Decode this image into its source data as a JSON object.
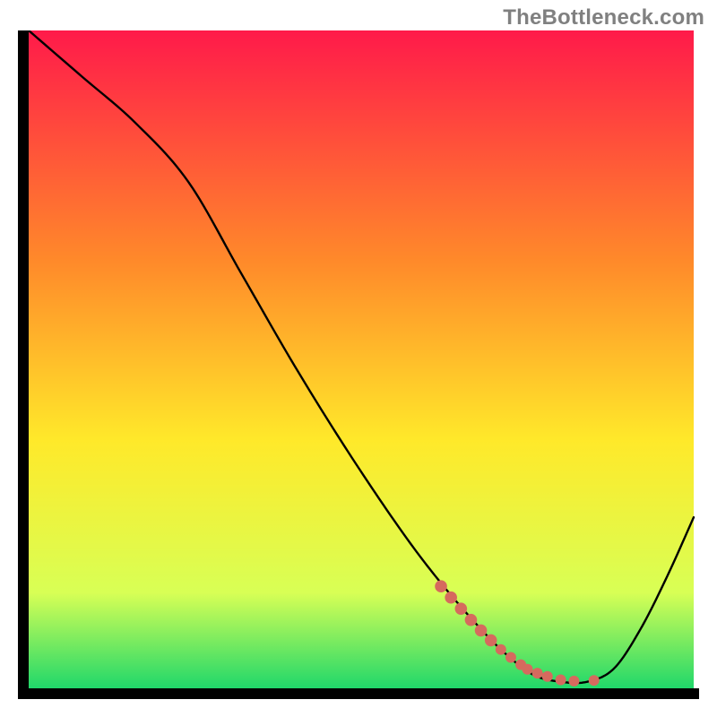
{
  "watermark": "TheBottleneck.com",
  "colors": {
    "axis": "#000000",
    "curve": "#000000",
    "dots": "#d66a5e",
    "gradient_top": "#ff1a4a",
    "gradient_mid_upper": "#ff8a2a",
    "gradient_mid": "#ffe92a",
    "gradient_low": "#d8ff55",
    "gradient_bottom": "#19d66b",
    "frame": "#000000"
  },
  "chart_data": {
    "type": "line",
    "title": "",
    "xlabel": "",
    "ylabel": "",
    "xlim": [
      0,
      100
    ],
    "ylim": [
      0,
      100
    ],
    "x": [
      0,
      8,
      16,
      24,
      32,
      40,
      48,
      56,
      62,
      68,
      72,
      76,
      80,
      84,
      88,
      92,
      96,
      100
    ],
    "y": [
      100,
      93,
      86,
      77,
      63,
      49,
      36,
      24,
      16,
      9,
      5,
      2,
      1,
      1,
      3,
      9,
      17,
      26
    ],
    "highlight_dots": {
      "x": [
        62,
        63.5,
        65,
        66.5,
        68,
        69.5,
        71,
        72.5,
        74,
        75,
        76.5,
        78,
        80,
        82,
        85
      ],
      "y": [
        15.5,
        13.8,
        12.1,
        10.4,
        8.8,
        7.3,
        5.9,
        4.7,
        3.6,
        2.9,
        2.3,
        1.8,
        1.3,
        1.1,
        1.2
      ]
    }
  }
}
